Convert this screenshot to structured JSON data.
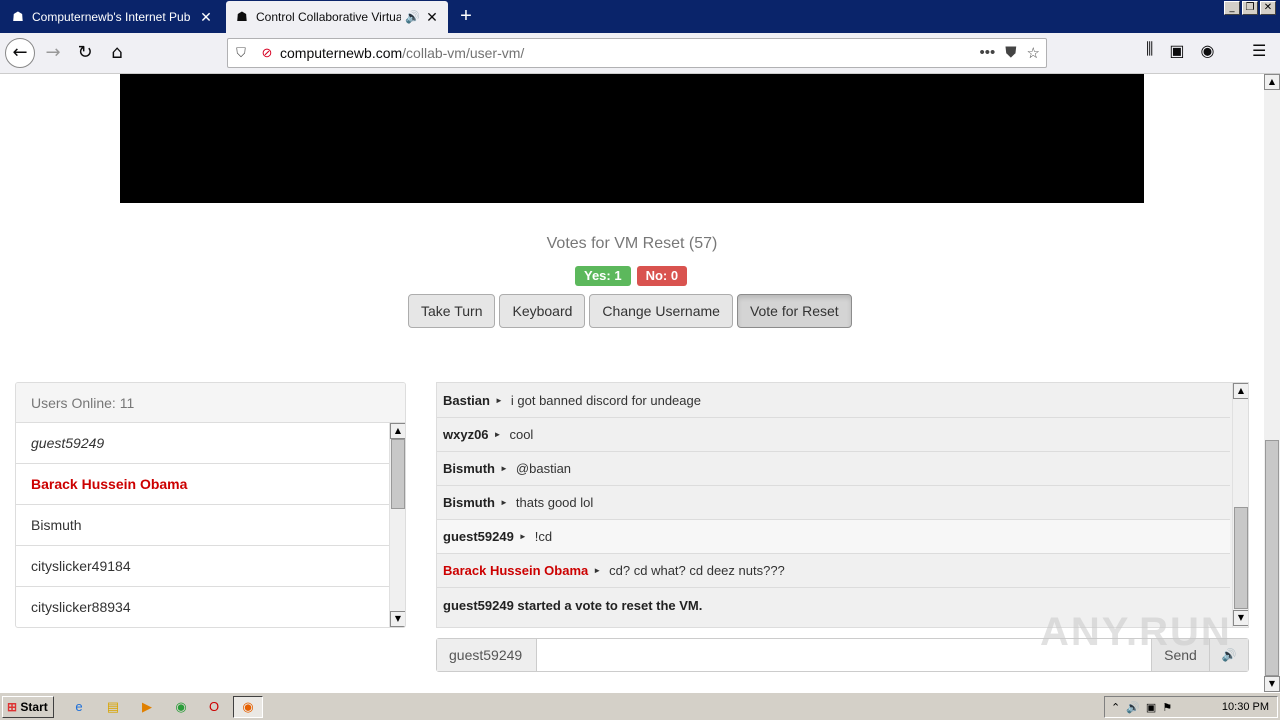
{
  "browser": {
    "tabs": [
      {
        "title": "Computernewb's Internet Pub Hub",
        "active": false
      },
      {
        "title": "Control Collaborative Virtual M",
        "active": true
      }
    ],
    "url_host": "computernewb.com",
    "url_path": "/collab-vm/user-vm/"
  },
  "vote": {
    "title": "Votes for VM Reset (57)",
    "yes_label": "Yes: 1",
    "no_label": "No: 0"
  },
  "buttons": {
    "take_turn": "Take Turn",
    "keyboard": "Keyboard",
    "change_username": "Change Username",
    "vote_reset": "Vote for Reset"
  },
  "users": {
    "header": "Users Online: 11",
    "list": [
      {
        "name": "guest59249",
        "style": "italic"
      },
      {
        "name": "Barack Hussein Obama",
        "style": "admin"
      },
      {
        "name": "Bismuth",
        "style": "normal"
      },
      {
        "name": "cityslicker49184",
        "style": "normal"
      },
      {
        "name": "cityslicker88934",
        "style": "normal"
      }
    ]
  },
  "chat": {
    "messages": [
      {
        "user": "Bastian",
        "text": "i got banned discord for undeage"
      },
      {
        "user": "wxyz06",
        "text": "cool"
      },
      {
        "user": "Bismuth",
        "text": "@bastian"
      },
      {
        "user": "Bismuth",
        "text": "thats good lol"
      },
      {
        "user": "guest59249",
        "text": "!cd"
      },
      {
        "user": "Barack Hussein Obama",
        "text": "cd? cd what? cd deez nuts???"
      }
    ],
    "system_message": "guest59249 started a vote to reset the VM.",
    "input_username": "guest59249",
    "send_label": "Send"
  },
  "watermark": "ANY.RUN",
  "taskbar": {
    "start_label": "Start",
    "clock": "10:30 PM"
  }
}
